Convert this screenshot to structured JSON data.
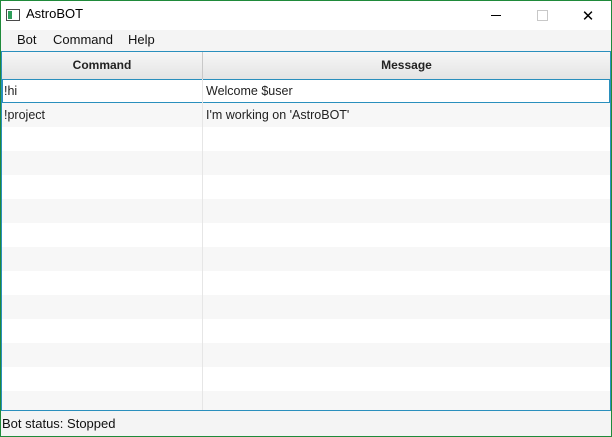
{
  "window": {
    "title": "AstroBOT",
    "minimize_glyph": "",
    "maximize_glyph": "",
    "close_glyph": "✕"
  },
  "menu": {
    "items": [
      "Bot",
      "Command",
      "Help"
    ]
  },
  "table": {
    "columns": [
      "Command",
      "Message"
    ],
    "rows": [
      {
        "command": "!hi",
        "message": "Welcome $user"
      },
      {
        "command": "!project",
        "message": "I'm working on 'AstroBOT'"
      }
    ],
    "selected_row": 0
  },
  "status": {
    "text": "Bot status: Stopped"
  },
  "colors": {
    "window_border": "#1f8a3a",
    "selection_border": "#2a8fbd",
    "header_bg": "#e9e9e9",
    "odd_row_bg": "#f7f7f7"
  }
}
